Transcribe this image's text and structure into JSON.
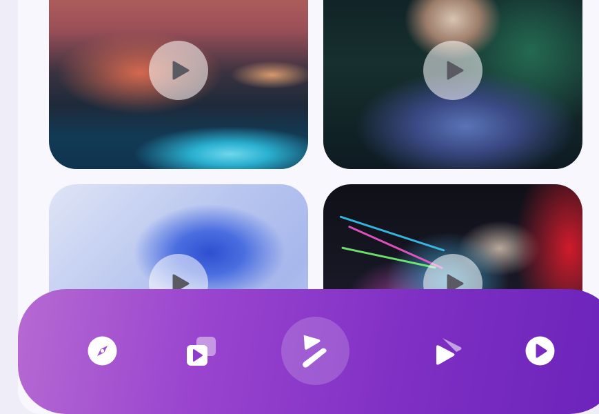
{
  "feed": {
    "cards": [
      {
        "name": "dj-turntable-video",
        "play_icon": "play-icon"
      },
      {
        "name": "dj-bandana-video",
        "play_icon": "play-icon"
      },
      {
        "name": "dj-headphones-video",
        "play_icon": "play-icon"
      },
      {
        "name": "dj-lights-video",
        "play_icon": "play-icon"
      }
    ]
  },
  "navbar": {
    "items": [
      {
        "icon": "compass-icon"
      },
      {
        "icon": "playlist-icon"
      },
      {
        "icon": "brand-logo-icon",
        "active": true
      },
      {
        "icon": "tv-play-icon"
      },
      {
        "icon": "play-circle-icon"
      }
    ],
    "gradient": [
      "#b66ad2",
      "#6a23b9"
    ]
  }
}
